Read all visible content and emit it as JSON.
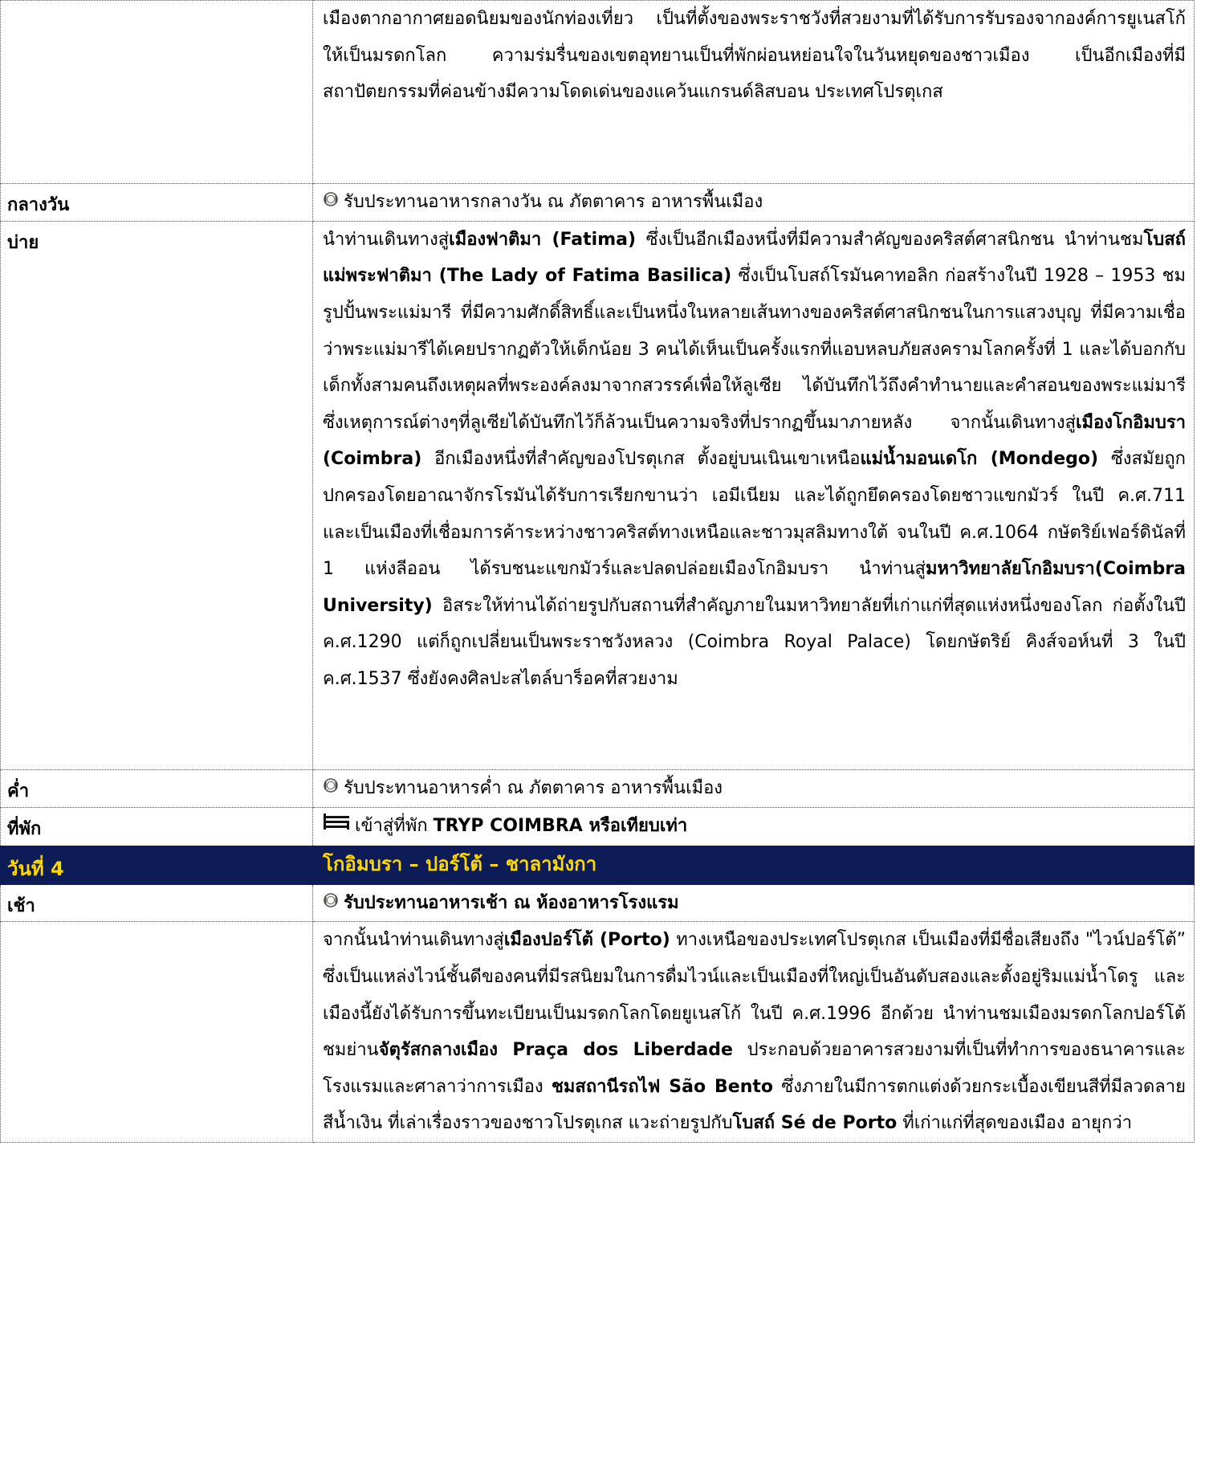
{
  "rows": [
    {
      "label": "",
      "segments": [
        {
          "t": "เมืองตากอากาศยอดนิยมของนักท่องเที่ยว เป็นที่ตั้งของพระราชวังที่สวยงามที่ได้รับการรับรองจากองค์การยูเนสโก้ให้เป็นมรดกโลก ความร่มรื่นของเขตอุทยานเป็นที่พักผ่อนหย่อนใจในวันหยุดของชาวเมือง เป็นอีกเมืองที่มีสถาปัตยกรรมที่ค่อนข้างมีความโดดเด่นของแคว้นแกรนด์ลิสบอน ประเทศโปรตุเกส",
          "b": false
        }
      ]
    },
    {
      "label": "กลางวัน",
      "icon": "meal-icon",
      "segments": [
        {
          "t": "รับประทานอาหารกลางวัน ณ ภัตตาคาร อาหารพื้นเมือง",
          "b": false
        }
      ]
    },
    {
      "label": "บ่าย",
      "segments": [
        {
          "t": "นำท่านเดินทางสู่",
          "b": false
        },
        {
          "t": "เมืองฟาติมา (Fatima)",
          "b": true
        },
        {
          "t": "  ซึ่งเป็นอีกเมืองหนึ่งที่มีความสำคัญของคริสต์ศาสนิกชน นำท่านชม",
          "b": false
        },
        {
          "t": "โบสถ์แม่พระฟาติมา (The Lady of Fatima Basilica)",
          "b": true
        },
        {
          "t": " ซึ่งเป็นโบสถ์โรมันคาทอลิก ก่อสร้างในปี 1928 –  1953 ชมรูปปั้นพระแม่มารี ที่มีความศักดิ์สิทธิ์และเป็นหนึ่งในหลายเส้นทางของคริสต์ศาสนิกชนในการแสวงบุญ ที่มีความเชื่อว่าพระแม่มารีได้เคยปรากฏตัวให้เด็กน้อย 3 คนได้เห็นเป็นครั้งแรกที่แอบหลบภัยสงครามโลกครั้งที่ 1 และได้บอกกับเด็กทั้งสามคนถึงเหตุผลที่พระองค์ลงมาจากสวรรค์เพื่อให้ลูเซีย ได้บันทึกไว้ถึงคำทำนายและคำสอนของพระแม่มารี ซึ่งเหตุการณ์ต่างๆที่ลูเซียได้บันทึกไว้ก็ล้วนเป็นความจริงที่ปรากฏขึ้นมาภายหลัง จากนั้นเดินทางสู่",
          "b": false
        },
        {
          "t": "เมืองโกอิมบรา (Coimbra)",
          "b": true
        },
        {
          "t": "  อีกเมืองหนึ่งที่สำคัญของโปรตุเกส ตั้งอยู่บนเนินเขาเหนือ",
          "b": false
        },
        {
          "t": "แม่น้ำมอนเดโก (Mondego)",
          "b": true
        },
        {
          "t": "  ซึ่งสมัยถูกปกครองโดยอาณาจักรโรมันได้รับการเรียกขานว่า เอมีเนียม และได้ถูกยึดครองโดยชาวแขกมัวร์ ในปี ค.ศ.711 และเป็นเมืองที่เชื่อมการค้าระหว่างชาวคริสต์ทางเหนือและชาวมุสลิมทางใต้ จนในปี ค.ศ.1064 กษัตริย์เฟอร์ดินัลที่ 1 แห่งลีออน ได้รบชนะแขกมัวร์และปลดปล่อยเมืองโกอิมบรา นำท่านสู่",
          "b": false
        },
        {
          "t": "มหาวิทยาลัยโกอิมบรา(Coimbra  University)",
          "b": true
        },
        {
          "t": " อิสระให้ท่านได้ถ่ายรูปกับสถานที่สำคัญภายในมหาวิทยาลัยที่เก่าแก่ที่สุดแห่งหนึ่งของโลก ก่อตั้งในปี ค.ศ.1290 แต่ก็ถูกเปลี่ยนเป็นพระราชวังหลวง (Coimbra Royal Palace) โดยกษัตริย์ คิงส์จอห์นที่ 3 ในปี ค.ศ.1537 ซึ่งยังคงศิลปะสไตล์บาร็อคที่สวยงาม",
          "b": false
        }
      ]
    },
    {
      "label": "ค่ำ",
      "icon": "meal-icon",
      "segments": [
        {
          "t": "รับประทานอาหารค่ำ ณ ภัตตาคาร อาหารพื้นเมือง",
          "b": false
        }
      ]
    },
    {
      "label": "ที่พัก",
      "icon": "bed-icon",
      "segments": [
        {
          "t": "เข้าสู่ที่พัก ",
          "b": false
        },
        {
          "t": "TRYP COIMBRA หรือเทียบเท่า",
          "b": true
        }
      ]
    },
    {
      "label": "วันที่ 4",
      "day": true,
      "segments": [
        {
          "t": "โกอิมบรา – ปอร์โต้ – ชาลามังกา",
          "b": true
        }
      ]
    },
    {
      "label": "เช้า",
      "icon": "meal-icon",
      "segments": [
        {
          "t": "รับประทานอาหารเช้า ณ ห้องอาหารโรงแรม",
          "b": true
        }
      ]
    },
    {
      "label": "",
      "segments": [
        {
          "t": "จากนั้นนำท่านเดินทางสู่",
          "b": false
        },
        {
          "t": "เมืองปอร์โต้ (Porto)",
          "b": true
        },
        {
          "t": "  ทางเหนือของประเทศโปรตุเกส เป็นเมืองที่มีชื่อเสียงถึง \"ไวน์ปอร์โต้” ซึ่งเป็นแหล่งไวน์ชั้นดีของคนที่มีรสนิยมในการดื่มไวน์และเป็นเมืองที่ใหญ่เป็นอันดับสองและตั้งอยู่ริมแม่น้ำโดรู และเมืองนี้ยังได้รับการขึ้นทะเบียนเป็นมรดกโลกโดยยูเนสโก้ ในปี ค.ศ.1996 อีกด้วย นำท่านชมเมืองมรดกโลกปอร์โต้ ชมย่าน",
          "b": false
        },
        {
          "t": "จัตุรัสกลางเมือง Praça dos Liberdade",
          "b": true
        },
        {
          "t": " ประกอบด้วยอาคารสวยงามที่เป็นที่ทำการของธนาคารและโรงแรมและศาลาว่าการเมือง ",
          "b": false
        },
        {
          "t": "ชมสถานีรถไฟ São Bento",
          "b": true
        },
        {
          "t": "  ซึ่งภายในมีการตกแต่งด้วยกระเบื้องเขียนสีที่มีลวดลายสีน้ำเงิน ที่เล่าเรื่องราวของชาวโปรตุเกส แวะถ่ายรูปกับ",
          "b": false
        },
        {
          "t": "โบสถ์ Sé de Porto",
          "b": true
        },
        {
          "t": " ที่เก่าแก่ที่สุดของเมือง อายุกว่า",
          "b": false
        }
      ]
    }
  ],
  "colors": {
    "day_bg": "#0d1b57",
    "day_fg": "#ffd800"
  }
}
